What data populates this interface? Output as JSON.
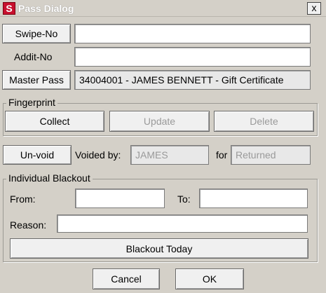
{
  "window": {
    "title": "Pass Dialog",
    "close_symbol": "x",
    "app_icon_letter": "S"
  },
  "pass": {
    "swipe_no_label": "Swipe-No",
    "swipe_no_value": "",
    "addit_no_label": "Addit-No",
    "addit_no_value": "",
    "master_pass_label": "Master Pass",
    "master_pass_value": "34004001 - JAMES BENNETT - Gift Certificate"
  },
  "fingerprint": {
    "title": "Fingerprint",
    "collect_label": "Collect",
    "update_label": "Update",
    "delete_label": "Delete"
  },
  "void": {
    "unvoid_label": "Un-void",
    "voided_by_label": "Voided by:",
    "voided_by_value": "JAMES",
    "for_label": "for",
    "for_value": "Returned"
  },
  "blackout": {
    "title": "Individual Blackout",
    "from_label": "From:",
    "from_value": "",
    "to_label": "To:",
    "to_value": "",
    "reason_label": "Reason:",
    "reason_value": "",
    "today_label": "Blackout Today"
  },
  "footer": {
    "cancel_label": "Cancel",
    "ok_label": "OK"
  }
}
